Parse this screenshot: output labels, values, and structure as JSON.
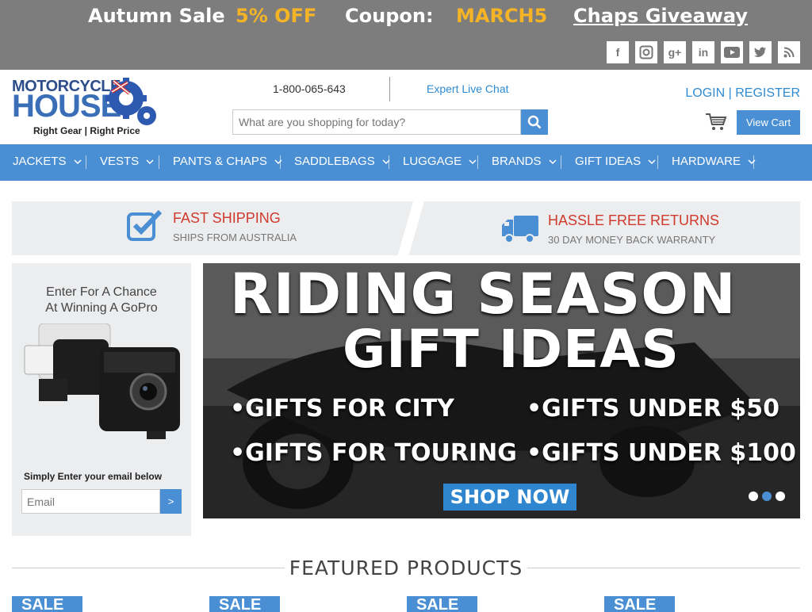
{
  "promo": {
    "sale_label": "Autumn Sale",
    "discount": "5% OFF",
    "coupon_label": "Coupon:",
    "coupon_code": "MARCH5",
    "giveaway": "Chaps Giveaway",
    "accent_color": "#f5b326"
  },
  "social": [
    "facebook-icon",
    "instagram-icon",
    "google-plus-icon",
    "linkedin-icon",
    "youtube-icon",
    "twitter-icon",
    "rss-icon"
  ],
  "logo": {
    "line1": "MOTORCYCLE",
    "line2": "HOUSE",
    "tagline": "Right Gear | Right Price"
  },
  "header": {
    "phone": "1-800-065-643",
    "chat": "Expert Live Chat",
    "search_placeholder": "What are you shopping for today?",
    "login": "LOGIN | REGISTER",
    "view_cart": "View Cart"
  },
  "nav": {
    "items": [
      {
        "label": "JACKETS"
      },
      {
        "label": "VESTS"
      },
      {
        "label": "PANTS & CHAPS"
      },
      {
        "label": "SADDLEBAGS"
      },
      {
        "label": "LUGGAGE"
      },
      {
        "label": "BRANDS"
      },
      {
        "label": "GIFT IDEAS"
      },
      {
        "label": "HARDWARE"
      }
    ],
    "color": "#4a8fd3"
  },
  "shipping": {
    "left_title": "FAST SHIPPING",
    "left_sub": "SHIPS FROM AUSTRALIA",
    "right_title": "HASSLE FREE RETURNS",
    "right_sub": "30 DAY MONEY BACK WARRANTY"
  },
  "sidebar": {
    "title_line1": "Enter For A Chance",
    "title_line2": "At Winning A GoPro",
    "label": "Simply Enter your email below",
    "email_placeholder": "Email",
    "submit": ">"
  },
  "banner": {
    "line1": "RIDING SEASON",
    "line2": "GIFT IDEAS",
    "bullet1": "•GIFTS FOR CITY",
    "bullet2": "•GIFTS UNDER $50",
    "bullet3": "•GIFTS FOR TOURING",
    "bullet4": "•GIFTS UNDER $100",
    "cta": "SHOP NOW",
    "active_slide": 2
  },
  "featured": {
    "title": "FEATURED PRODUCTS",
    "sale_badge": "SALE"
  }
}
